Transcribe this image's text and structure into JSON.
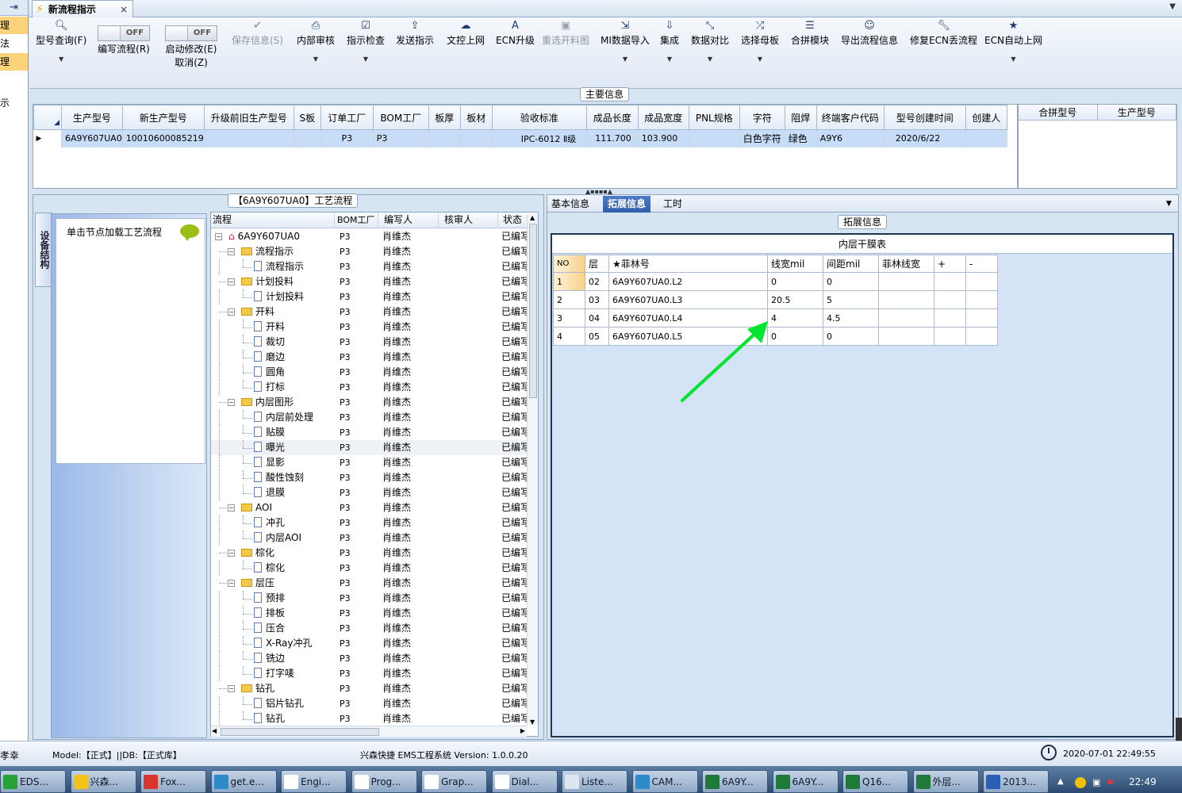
{
  "left_strip": {
    "items": [
      "理",
      "法",
      "理"
    ],
    "fragment": "示"
  },
  "doc_tab": {
    "title": "新流程指示"
  },
  "ribbon": {
    "buttons": [
      {
        "label": "型号查询(F)",
        "icon": "search-icon"
      },
      {
        "label": "编写流程(R)",
        "toggle": "OFF"
      },
      {
        "label": "启动修改(E)",
        "label2": "取消(Z)",
        "toggle": "OFF"
      },
      {
        "label": "保存信息(S)",
        "icon": "check-icon",
        "disabled": true
      },
      {
        "label": "内部审核",
        "icon": "printer-icon"
      },
      {
        "label": "指示检查",
        "icon": "checkbox-icon"
      },
      {
        "label": "发送指示",
        "icon": "upload-icon"
      },
      {
        "label": "文控上网",
        "icon": "cloud-upload-icon"
      },
      {
        "label": "ECN升级",
        "icon": "font-icon"
      },
      {
        "label": "重选开料图",
        "icon": "image-icon",
        "disabled": true
      },
      {
        "label": "MI数据导入",
        "icon": "import-icon"
      },
      {
        "label": "集成",
        "icon": "download-icon"
      },
      {
        "label": "数据对比",
        "icon": "compress-icon"
      },
      {
        "label": "选择母板",
        "icon": "shuffle-icon"
      },
      {
        "label": "合拼模块",
        "icon": "list-icon"
      },
      {
        "label": "导出流程信息",
        "icon": "smile-icon"
      },
      {
        "label": "修复ECN丢流程",
        "icon": "wrench-icon"
      },
      {
        "label": "ECN自动上网",
        "icon": "star-icon"
      }
    ]
  },
  "main_info": {
    "title": "主要信息",
    "columns": [
      "生产型号",
      "新生产型号",
      "升级前旧生产型号",
      "S板",
      "订单工厂",
      "BOM工厂",
      "板厚",
      "板材",
      "验收标准",
      "成品长度",
      "成品宽度",
      "PNL规格",
      "字符",
      "阻焊",
      "终端客户代码",
      "型号创建时间",
      "创建人"
    ],
    "rows": [
      [
        "6A9Y607UA0",
        "10010600085219",
        "",
        "",
        "P3",
        "P3",
        "",
        "",
        "IPC-6012 Ⅱ级",
        "111.700",
        "103.900",
        "",
        "白色字符",
        "绿色",
        "A9Y6",
        "2020/6/22",
        ""
      ]
    ],
    "side_columns": [
      "合拼型号",
      "生产型号"
    ]
  },
  "process_panel": {
    "title": "【6A9Y607UA0】工艺流程",
    "side_tab": "设备结构",
    "tip": "单击节点加载工艺流程",
    "columns": [
      "流程",
      "BOM工厂",
      "编写人",
      "核审人",
      "状态"
    ],
    "root": "6A9Y607UA0",
    "groups": [
      {
        "name": "流程指示",
        "children": [
          "流程指示"
        ]
      },
      {
        "name": "计划投料",
        "children": [
          "计划投料"
        ]
      },
      {
        "name": "开料",
        "children": [
          "开料",
          "裁切",
          "磨边",
          "圆角",
          "打标"
        ]
      },
      {
        "name": "内层图形",
        "children": [
          "内层前处理",
          "贴膜",
          "曝光",
          "显影",
          "酸性蚀刻",
          "退膜"
        ]
      },
      {
        "name": "AOI",
        "children": [
          "冲孔",
          "内层AOI"
        ]
      },
      {
        "name": "棕化",
        "children": [
          "棕化"
        ]
      },
      {
        "name": "层压",
        "children": [
          "预排",
          "排板",
          "压合",
          "X-Ray冲孔",
          "铣边",
          "打字唛"
        ]
      },
      {
        "name": "钻孔",
        "children": [
          "铝片钻孔",
          "钻孔"
        ]
      }
    ],
    "bom": "P3",
    "writer": "肖维杰",
    "status": "已编写",
    "highlighted": "曝光"
  },
  "right_panel": {
    "tabs": [
      "基本信息",
      "拓展信息",
      "工时"
    ],
    "active_tab": "拓展信息",
    "group_title": "拓展信息",
    "table_title": "内层干膜表",
    "columns": [
      "NO",
      "层",
      "★菲林号",
      "线宽mil",
      "间距mil",
      "菲林线宽",
      "+",
      "-"
    ],
    "rows": [
      [
        "1",
        "02",
        "6A9Y607UA0.L2",
        "0",
        "0",
        "",
        "",
        ""
      ],
      [
        "2",
        "03",
        "6A9Y607UA0.L3",
        "20.5",
        "5",
        "",
        "",
        ""
      ],
      [
        "3",
        "04",
        "6A9Y607UA0.L4",
        "4",
        "4.5",
        "",
        "",
        ""
      ],
      [
        "4",
        "05",
        "6A9Y607UA0.L5",
        "0",
        "0",
        "",
        "",
        ""
      ]
    ],
    "arrow_color": "#00e62e"
  },
  "status_bar": {
    "user": "孝幸",
    "env": "Model:【正式】||DB:【正式库】",
    "system": "兴森快捷 EMS工程系统 Version: 1.0.0.20",
    "datetime": "2020-07-01 22:49:55"
  },
  "taskbar": {
    "items": [
      "EDS...",
      "兴森...",
      "Fox...",
      "get.e...",
      "Engi...",
      "Prog...",
      "Grap...",
      "Dial...",
      "Liste...",
      "CAM...",
      "6A9Y...",
      "6A9Y...",
      "Q16...",
      "外层...",
      "2013..."
    ],
    "time": "22:49"
  }
}
